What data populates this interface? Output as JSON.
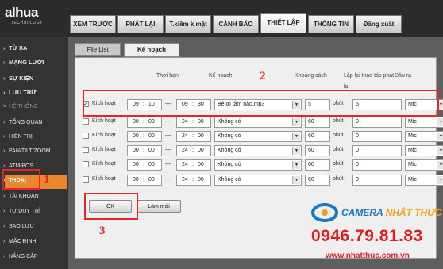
{
  "brand": {
    "logo": "alhua",
    "logo_sub": "TECHNOLOGY"
  },
  "topnav": [
    "XEM TRƯỚC",
    "PHÁT LẠI",
    "T.kiếm k.mật",
    "CẢNH BÁO",
    "THIẾT LẬP",
    "THÔNG TIN",
    "Đăng xuất"
  ],
  "topnav_active": "THIẾT LẬP",
  "sidebar": [
    {
      "label": "TỪ XA",
      "kind": "main"
    },
    {
      "label": "MẠNG LƯỚI",
      "kind": "main"
    },
    {
      "label": "SỰ KIỆN",
      "kind": "main"
    },
    {
      "label": "LƯU TRỮ",
      "kind": "main"
    },
    {
      "label": "HỆ THỐNG",
      "kind": "header"
    },
    {
      "label": "TỔNG QUAN",
      "kind": "sub"
    },
    {
      "label": "HIỂN THỊ",
      "kind": "sub"
    },
    {
      "label": "PAN/TILT/ZOOM",
      "kind": "sub"
    },
    {
      "label": "ATM/POS",
      "kind": "sub"
    },
    {
      "label": "THOẠI",
      "kind": "sub",
      "active": true
    },
    {
      "label": "TÀI KHOẢN",
      "kind": "sub"
    },
    {
      "label": "TỰ DUY TRÌ",
      "kind": "sub"
    },
    {
      "label": "SAO LƯU",
      "kind": "sub"
    },
    {
      "label": "MẶC ĐỊNH",
      "kind": "sub"
    },
    {
      "label": "NÂNG CẤP",
      "kind": "sub"
    }
  ],
  "subtabs": [
    "File List",
    "Kế hoạch"
  ],
  "subtab_active": "Kế hoạch",
  "headers": {
    "time": "Thời hạn",
    "plan": "Kế hoạch",
    "interval": "Khoảng cách",
    "repeat_line1": "Lặp lại thao tác phát",
    "repeat_line2": "lại",
    "output": "Đầu ra"
  },
  "rows": [
    {
      "checked": true,
      "label": "Kích hoạt",
      "start_h": "09",
      "start_m": "10",
      "end_h": "09",
      "end_m": "30",
      "file": "Bé ơi tắm nào.mp3",
      "interval": "5",
      "unit": "phút",
      "repeat": "5",
      "output": "Mic"
    },
    {
      "checked": false,
      "label": "Kích hoạt",
      "start_h": "00",
      "start_m": "00",
      "end_h": "24",
      "end_m": "00",
      "file": "Không có",
      "interval": "60",
      "unit": "phút",
      "repeat": "0",
      "output": "Mic"
    },
    {
      "checked": false,
      "label": "Kích hoạt",
      "start_h": "00",
      "start_m": "00",
      "end_h": "24",
      "end_m": "00",
      "file": "Không có",
      "interval": "60",
      "unit": "phút",
      "repeat": "0",
      "output": "Mic"
    },
    {
      "checked": false,
      "label": "Kích hoạt",
      "start_h": "00",
      "start_m": "00",
      "end_h": "24",
      "end_m": "00",
      "file": "Không có",
      "interval": "60",
      "unit": "phút",
      "repeat": "0",
      "output": "Mic"
    },
    {
      "checked": false,
      "label": "Kích hoạt",
      "start_h": "00",
      "start_m": "00",
      "end_h": "24",
      "end_m": "00",
      "file": "Không có",
      "interval": "60",
      "unit": "phút",
      "repeat": "0",
      "output": "Mic"
    },
    {
      "checked": false,
      "label": "Kích hoạt",
      "start_h": "00",
      "start_m": "00",
      "end_h": "24",
      "end_m": "00",
      "file": "Không có",
      "interval": "60",
      "unit": "phút",
      "repeat": "0",
      "output": "Mic"
    }
  ],
  "buttons": {
    "ok": "OK",
    "refresh": "Làm mới"
  },
  "annotations": {
    "n1": "1",
    "n2": "2",
    "n3": "3"
  },
  "watermark": {
    "brand1": "CAMERA",
    "brand2": "NHẬT THỰC",
    "phone": "0946.79.81.83",
    "url": "www.nhatthuc.com.vn"
  },
  "colors": {
    "accent_orange": "#e8872b",
    "annotation_red": "#e3262b",
    "watermark_blue": "#1a78c2",
    "watermark_red": "#e01d24"
  }
}
